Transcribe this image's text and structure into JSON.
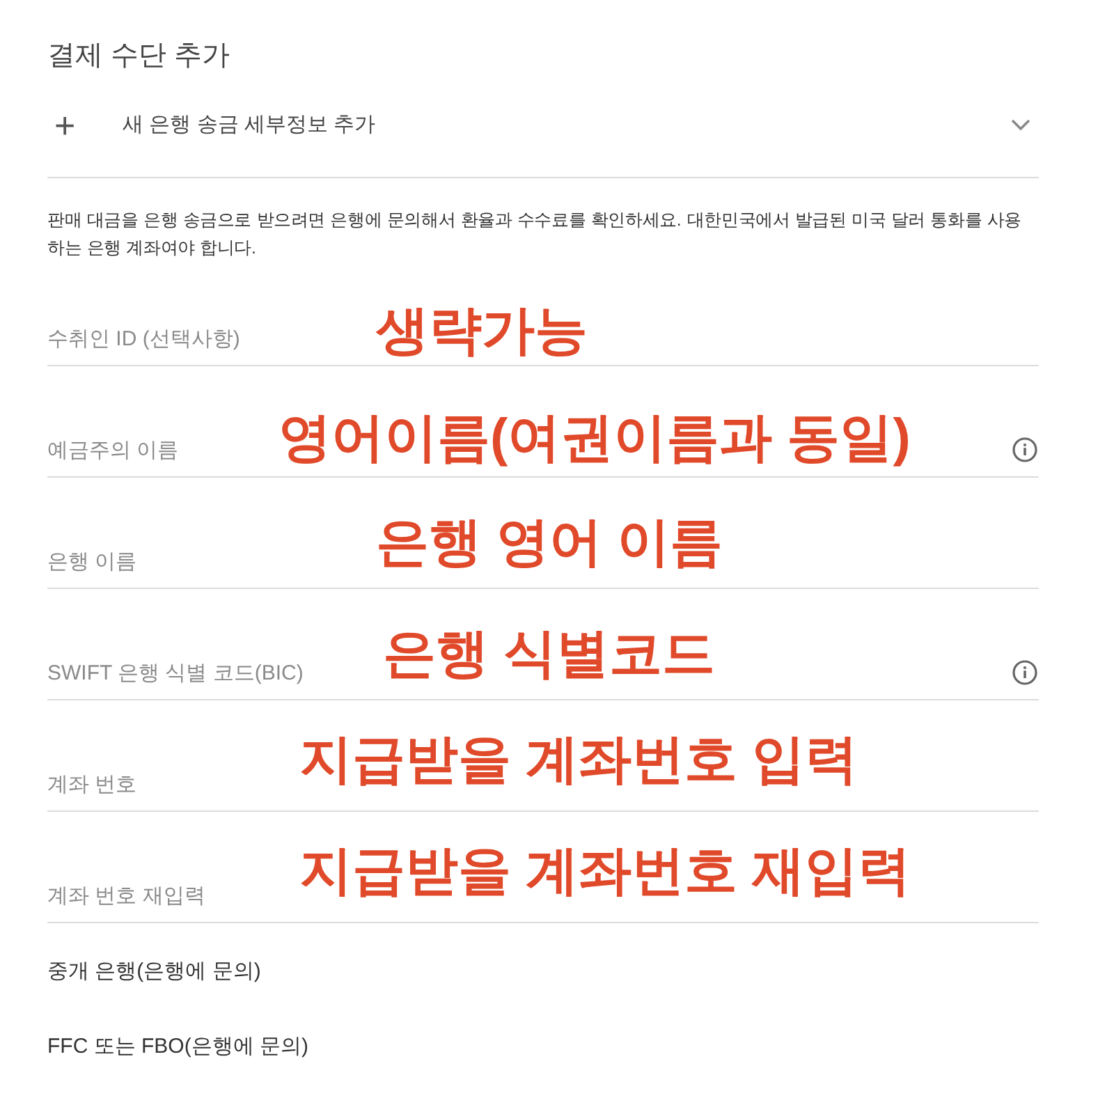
{
  "title": "결제 수단 추가",
  "section": {
    "icon": "+",
    "label": "새 은행 송금 세부정보 추가"
  },
  "notice": "판매 대금을 은행 송금으로 받으려면 은행에 문의해서 환율과 수수료를 확인하세요. 대한민국에서 발급된 미국 달러 통화를 사용하는 은행 계좌여야 합니다.",
  "fields": [
    {
      "placeholder": "수취인 ID (선택사항)",
      "info": false,
      "annotation": "생략가능"
    },
    {
      "placeholder": "예금주의 이름",
      "info": true,
      "annotation": "영어이름(여권이름과 동일)"
    },
    {
      "placeholder": "은행 이름",
      "info": false,
      "annotation": "은행 영어 이름"
    },
    {
      "placeholder": "SWIFT 은행 식별 코드(BIC)",
      "info": true,
      "annotation": "은행 식별코드"
    },
    {
      "placeholder": "계좌 번호",
      "info": false,
      "annotation": "지급받을 계좌번호 입력"
    },
    {
      "placeholder": "계좌 번호 재입력",
      "info": false,
      "annotation": "지급받을 계좌번호 재입력"
    }
  ],
  "links": [
    "중개 은행(은행에 문의)",
    "FFC 또는 FBO(은행에 문의)"
  ]
}
